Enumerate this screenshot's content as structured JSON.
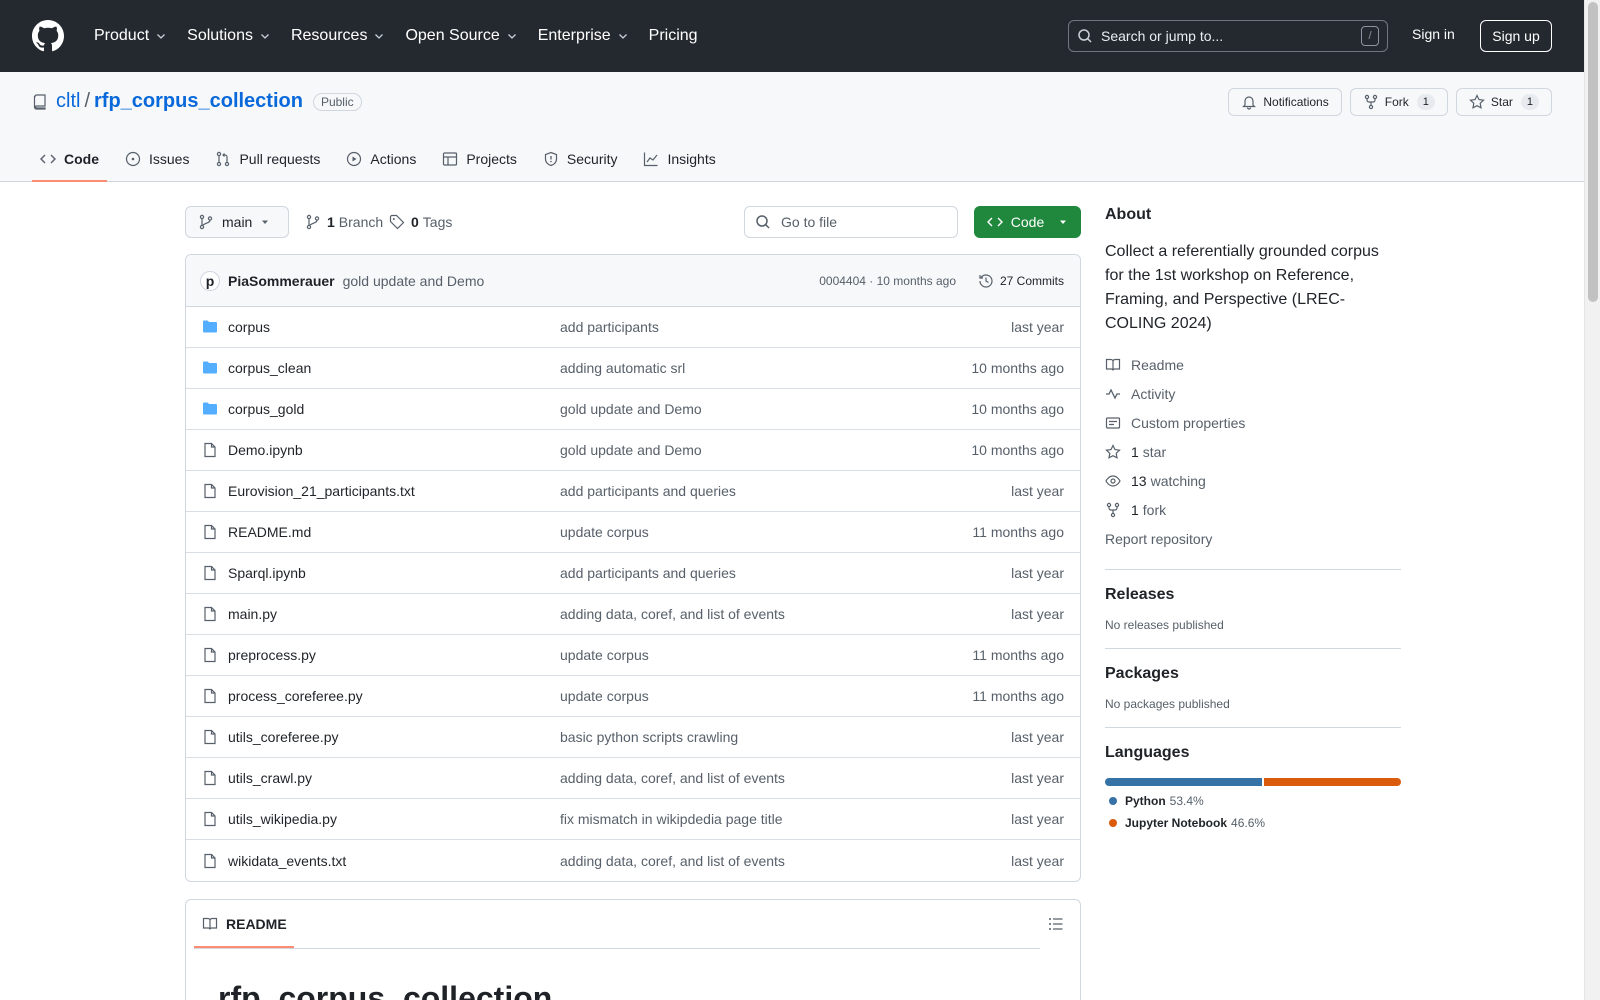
{
  "header": {
    "nav": [
      {
        "label": "Product",
        "chevron": true
      },
      {
        "label": "Solutions",
        "chevron": true
      },
      {
        "label": "Resources",
        "chevron": true
      },
      {
        "label": "Open Source",
        "chevron": true
      },
      {
        "label": "Enterprise",
        "chevron": true
      },
      {
        "label": "Pricing",
        "chevron": false
      }
    ],
    "search_placeholder": "Search or jump to...",
    "search_shortcut": "/",
    "signin": "Sign in",
    "signup": "Sign up"
  },
  "repo": {
    "owner": "cltl",
    "separator": "/",
    "name": "rfp_corpus_collection",
    "visibility": "Public",
    "notifications_label": "Notifications",
    "fork_label": "Fork",
    "fork_count": "1",
    "star_label": "Star",
    "star_count": "1",
    "tabs": [
      {
        "label": "Code",
        "icon": "code-icon"
      },
      {
        "label": "Issues",
        "icon": "issue-icon"
      },
      {
        "label": "Pull requests",
        "icon": "pull-request-icon"
      },
      {
        "label": "Actions",
        "icon": "play-icon"
      },
      {
        "label": "Projects",
        "icon": "table-icon"
      },
      {
        "label": "Security",
        "icon": "shield-icon"
      },
      {
        "label": "Insights",
        "icon": "graph-icon"
      }
    ]
  },
  "toolbar": {
    "branch": "main",
    "branch_count": "1",
    "branch_label": "Branch",
    "tag_count": "0",
    "tag_label": "Tags",
    "goto_placeholder": "Go to file",
    "code_button": "Code"
  },
  "latest_commit": {
    "avatar_letter": "p",
    "author": "PiaSommerauer",
    "message": "gold update and Demo",
    "meta": "0004404 · 10 months ago",
    "commits_label": "27 Commits"
  },
  "files": [
    {
      "name": "corpus",
      "type": "dir",
      "message": "add participants",
      "time": "last year"
    },
    {
      "name": "corpus_clean",
      "type": "dir",
      "message": "adding automatic srl",
      "time": "10 months ago"
    },
    {
      "name": "corpus_gold",
      "type": "dir",
      "message": "gold update and Demo",
      "time": "10 months ago"
    },
    {
      "name": "Demo.ipynb",
      "type": "file",
      "message": "gold update and Demo",
      "time": "10 months ago"
    },
    {
      "name": "Eurovision_21_participants.txt",
      "type": "file",
      "message": "add participants and queries",
      "time": "last year"
    },
    {
      "name": "README.md",
      "type": "file",
      "message": "update corpus",
      "time": "11 months ago"
    },
    {
      "name": "Sparql.ipynb",
      "type": "file",
      "message": "add participants and queries",
      "time": "last year"
    },
    {
      "name": "main.py",
      "type": "file",
      "message": "adding data, coref, and list of events",
      "time": "last year"
    },
    {
      "name": "preprocess.py",
      "type": "file",
      "message": "update corpus",
      "time": "11 months ago"
    },
    {
      "name": "process_coreferee.py",
      "type": "file",
      "message": "update corpus",
      "time": "11 months ago"
    },
    {
      "name": "utils_coreferee.py",
      "type": "file",
      "message": "basic python scripts crawling",
      "time": "last year"
    },
    {
      "name": "utils_crawl.py",
      "type": "file",
      "message": "adding data, coref, and list of events",
      "time": "last year"
    },
    {
      "name": "utils_wikipedia.py",
      "type": "file",
      "message": "fix mismatch in wikipdedia page title",
      "time": "last year"
    },
    {
      "name": "wikidata_events.txt",
      "type": "file",
      "message": "adding data, coref, and list of events",
      "time": "last year"
    }
  ],
  "readme": {
    "tab_label": "README",
    "heading": "rfp_corpus_collection"
  },
  "about": {
    "title": "About",
    "description": "Collect a referentially grounded corpus for the 1st workshop on Reference, Framing, and Perspective (LREC-COLING 2024)",
    "links": [
      {
        "icon": "book-icon",
        "count": "",
        "label": "Readme"
      },
      {
        "icon": "pulse-icon",
        "count": "",
        "label": "Activity"
      },
      {
        "icon": "note-icon",
        "count": "",
        "label": "Custom properties"
      },
      {
        "icon": "star-icon",
        "count": "1",
        "label": "star"
      },
      {
        "icon": "eye-icon",
        "count": "13",
        "label": "watching"
      },
      {
        "icon": "fork-icon",
        "count": "1",
        "label": "fork"
      }
    ],
    "report": "Report repository"
  },
  "releases": {
    "title": "Releases",
    "empty": "No releases published"
  },
  "packages": {
    "title": "Packages",
    "empty": "No packages published"
  },
  "languages": {
    "title": "Languages",
    "items": [
      {
        "name": "Python",
        "percent": "53.4%",
        "share": 53.4,
        "color": "#3572A5"
      },
      {
        "name": "Jupyter Notebook",
        "percent": "46.6%",
        "share": 46.6,
        "color": "#DA5B0B"
      }
    ]
  }
}
